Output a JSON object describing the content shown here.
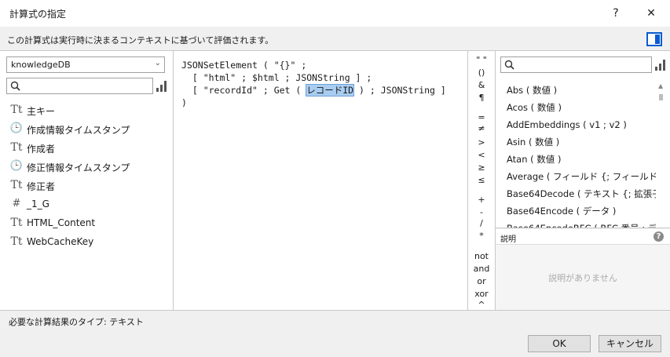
{
  "dialog": {
    "title": "計算式の指定",
    "help_glyph": "?",
    "close_glyph": "✕"
  },
  "info_text": "この計算式は実行時に決まるコンテキストに基づいて評価されます。",
  "left_panel": {
    "table_select": "knowledgeDB",
    "search_placeholder": "",
    "fields": [
      {
        "icon": "text-field-icon",
        "glyph": "Tt",
        "label": "主キー"
      },
      {
        "icon": "timestamp-field-icon",
        "glyph": "🕒",
        "label": "作成情報タイムスタンプ"
      },
      {
        "icon": "text-field-icon",
        "glyph": "Tt",
        "label": "作成者"
      },
      {
        "icon": "timestamp-field-icon",
        "glyph": "🕒",
        "label": "修正情報タイムスタンプ"
      },
      {
        "icon": "text-field-icon",
        "glyph": "Tt",
        "label": "修正者"
      },
      {
        "icon": "number-field-icon",
        "glyph": "#",
        "label": "_1_G"
      },
      {
        "icon": "text-field-icon",
        "glyph": "Tt",
        "label": "HTML_Content"
      },
      {
        "icon": "text-field-icon",
        "glyph": "Tt",
        "label": "WebCacheKey"
      }
    ]
  },
  "editor": {
    "line1": "JSONSetElement ( \"{}\" ;",
    "line2": "  [ \"html\" ; $html ; JSONString ] ;",
    "line3_pre": "  [ \"recordId\" ; Get ( ",
    "line3_sel": "レコードID",
    "line3_post": " ) ; JSONString ]",
    "line4": ")"
  },
  "operators": [
    "\" \"",
    "()",
    "&",
    "¶",
    "=",
    "≠",
    ">",
    "<",
    "≥",
    "≤",
    "+",
    "-",
    "/",
    "*",
    "not",
    "and",
    "or",
    "xor",
    "^"
  ],
  "functions": {
    "search_placeholder": "",
    "items": [
      "Abs ( 数値 )",
      "Acos ( 数値 )",
      "AddEmbeddings ( v1 ; v2 )",
      "Asin ( 数値 )",
      "Atan ( 数値 )",
      "Average ( フィールド {; フィールド...} )",
      "Base64Decode ( テキスト {; 拡張子...",
      "Base64Encode ( データ )",
      "Base64EncodeRFC ( RFC 番号 ; デ..."
    ]
  },
  "description": {
    "title": "説明",
    "empty_text": "説明がありません"
  },
  "result_type_label": "必要な計算結果のタイプ: テキスト",
  "buttons": {
    "ok": "OK",
    "cancel": "キャンセル"
  }
}
